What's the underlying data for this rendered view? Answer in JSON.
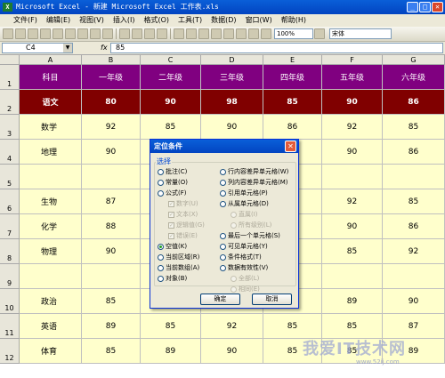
{
  "window": {
    "title": "Microsoft Excel - 新建 Microsoft Excel 工作表.xls",
    "app_icon": "X"
  },
  "menu": [
    "文件(F)",
    "编辑(E)",
    "视图(V)",
    "插入(I)",
    "格式(O)",
    "工具(T)",
    "数据(D)",
    "窗口(W)",
    "帮助(H)"
  ],
  "toolbar": {
    "zoom": "100%",
    "font": "宋体"
  },
  "formula": {
    "cell_ref": "C4",
    "fx": "fx",
    "value": "85"
  },
  "columns": [
    "A",
    "B",
    "C",
    "D",
    "E",
    "F",
    "G"
  ],
  "header_row": [
    "科目",
    "一年级",
    "二年级",
    "三年级",
    "四年级",
    "五年级",
    "六年级"
  ],
  "rows": [
    [
      "语文",
      "80",
      "90",
      "98",
      "85",
      "90",
      "86"
    ],
    [
      "数学",
      "92",
      "85",
      "90",
      "86",
      "92",
      "85"
    ],
    [
      "地理",
      "90",
      "",
      "",
      "",
      "90",
      "86"
    ],
    [
      "",
      "",
      "",
      "",
      "",
      "",
      ""
    ],
    [
      "生物",
      "87",
      "",
      "",
      "",
      "92",
      "85"
    ],
    [
      "化学",
      "88",
      "",
      "",
      "",
      "90",
      "86"
    ],
    [
      "物理",
      "90",
      "",
      "",
      "",
      "85",
      "92"
    ],
    [
      "",
      "",
      "",
      "",
      "",
      "",
      ""
    ],
    [
      "政治",
      "85",
      "",
      "",
      "",
      "89",
      "90"
    ],
    [
      "英语",
      "89",
      "85",
      "92",
      "85",
      "85",
      "87"
    ],
    [
      "体育",
      "85",
      "89",
      "90",
      "85",
      "85",
      "89"
    ]
  ],
  "row_numbers": [
    "1",
    "2",
    "3",
    "4",
    "5",
    "6",
    "7",
    "8",
    "9",
    "10",
    "11",
    "12"
  ],
  "colors": {
    "header_bg": "#800080",
    "header_text": "#ffffff",
    "row2_bg": "#800000",
    "row2_text": "#ffffff",
    "cell_bg": "#ffffcc"
  },
  "dialog": {
    "title": "定位条件",
    "group_label": "选择",
    "left_options": [
      {
        "label": "批注(C)",
        "selected": false,
        "disabled": false,
        "kind": "radio"
      },
      {
        "label": "常量(O)",
        "selected": false,
        "disabled": false,
        "kind": "radio"
      },
      {
        "label": "公式(F)",
        "selected": false,
        "disabled": false,
        "kind": "radio"
      },
      {
        "label": "数字(U)",
        "selected": false,
        "disabled": true,
        "kind": "check"
      },
      {
        "label": "文本(X)",
        "selected": false,
        "disabled": true,
        "kind": "check"
      },
      {
        "label": "逻辑值(G)",
        "selected": false,
        "disabled": true,
        "kind": "check"
      },
      {
        "label": "错误(E)",
        "selected": false,
        "disabled": true,
        "kind": "check"
      },
      {
        "label": "空值(K)",
        "selected": true,
        "disabled": false,
        "kind": "radio"
      },
      {
        "label": "当前区域(R)",
        "selected": false,
        "disabled": false,
        "kind": "radio"
      },
      {
        "label": "当前数组(A)",
        "selected": false,
        "disabled": false,
        "kind": "radio"
      },
      {
        "label": "对象(B)",
        "selected": false,
        "disabled": false,
        "kind": "radio"
      }
    ],
    "right_options": [
      {
        "label": "行内容差异单元格(W)",
        "selected": false,
        "disabled": false
      },
      {
        "label": "列内容差异单元格(M)",
        "selected": false,
        "disabled": false
      },
      {
        "label": "引用单元格(P)",
        "selected": false,
        "disabled": false
      },
      {
        "label": "从属单元格(D)",
        "selected": false,
        "disabled": false
      },
      {
        "label": "直属(I)",
        "selected": false,
        "disabled": true
      },
      {
        "label": "所有级别(L)",
        "selected": false,
        "disabled": true
      },
      {
        "label": "最后一个单元格(S)",
        "selected": false,
        "disabled": false
      },
      {
        "label": "可见单元格(Y)",
        "selected": false,
        "disabled": false
      },
      {
        "label": "条件格式(T)",
        "selected": false,
        "disabled": false
      },
      {
        "label": "数据有效性(V)",
        "selected": false,
        "disabled": false
      },
      {
        "label": "全部(L)",
        "selected": false,
        "disabled": true
      },
      {
        "label": "相同(E)",
        "selected": false,
        "disabled": true
      }
    ],
    "ok": "确定",
    "cancel": "取消"
  },
  "watermark": {
    "text": "我爱IT技术网",
    "url": "www.52ij.com"
  }
}
